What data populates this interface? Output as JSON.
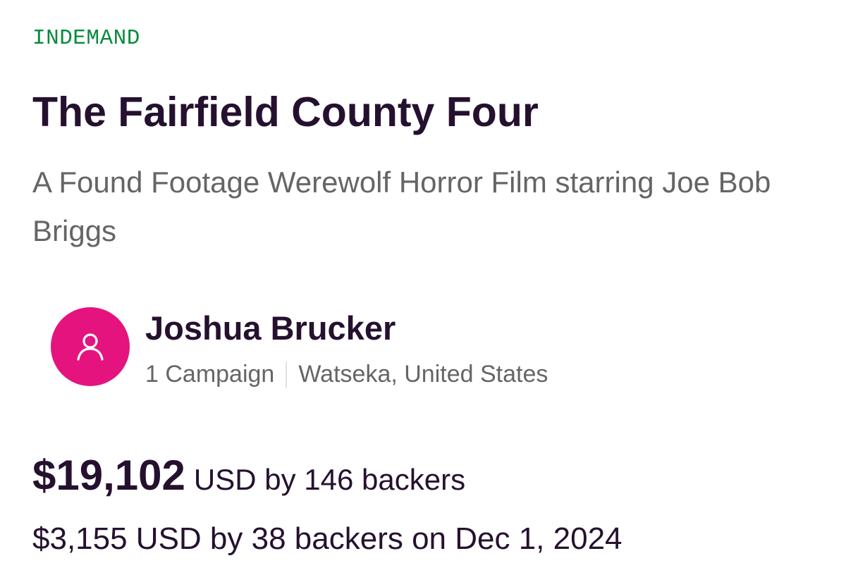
{
  "platform": {
    "badge": "INDEMAND",
    "badge_color": "#0a8a3e"
  },
  "campaign": {
    "title": "The Fairfield County Four",
    "subtitle": "A Found Footage Werewolf Horror Film starring Joe Bob Briggs"
  },
  "creator": {
    "name": "Joshua Brucker",
    "campaigns": "1 Campaign",
    "location": "Watseka, United States",
    "avatar_icon": "user-icon",
    "avatar_color": "#e5137e"
  },
  "funding": {
    "total": "$19,102",
    "total_suffix": "USD by 146 backers",
    "daily": "$3,155 USD by 38 backers on Dec 1, 2024"
  }
}
